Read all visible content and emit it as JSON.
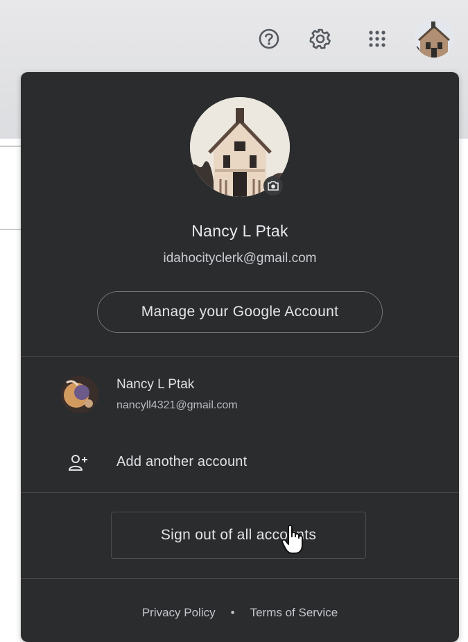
{
  "topbar": {
    "icons": [
      "help-icon",
      "settings-icon",
      "apps-grid-icon",
      "account-avatar-icon"
    ]
  },
  "profile": {
    "name": "Nancy L Ptak",
    "email": "idahocityclerk@gmail.com",
    "manage_label": "Manage your Google Account"
  },
  "accounts": [
    {
      "name": "Nancy L Ptak",
      "email": "nancyll4321@gmail.com"
    }
  ],
  "add_account_label": "Add another account",
  "signout_label": "Sign out of all accounts",
  "footer": {
    "privacy": "Privacy Policy",
    "separator": "•",
    "terms": "Terms of Service"
  },
  "colors": {
    "panel_bg": "#2b2c2e",
    "text_primary": "#e8eaed",
    "text_secondary": "#c9ccd1",
    "divider": "#45474a"
  }
}
